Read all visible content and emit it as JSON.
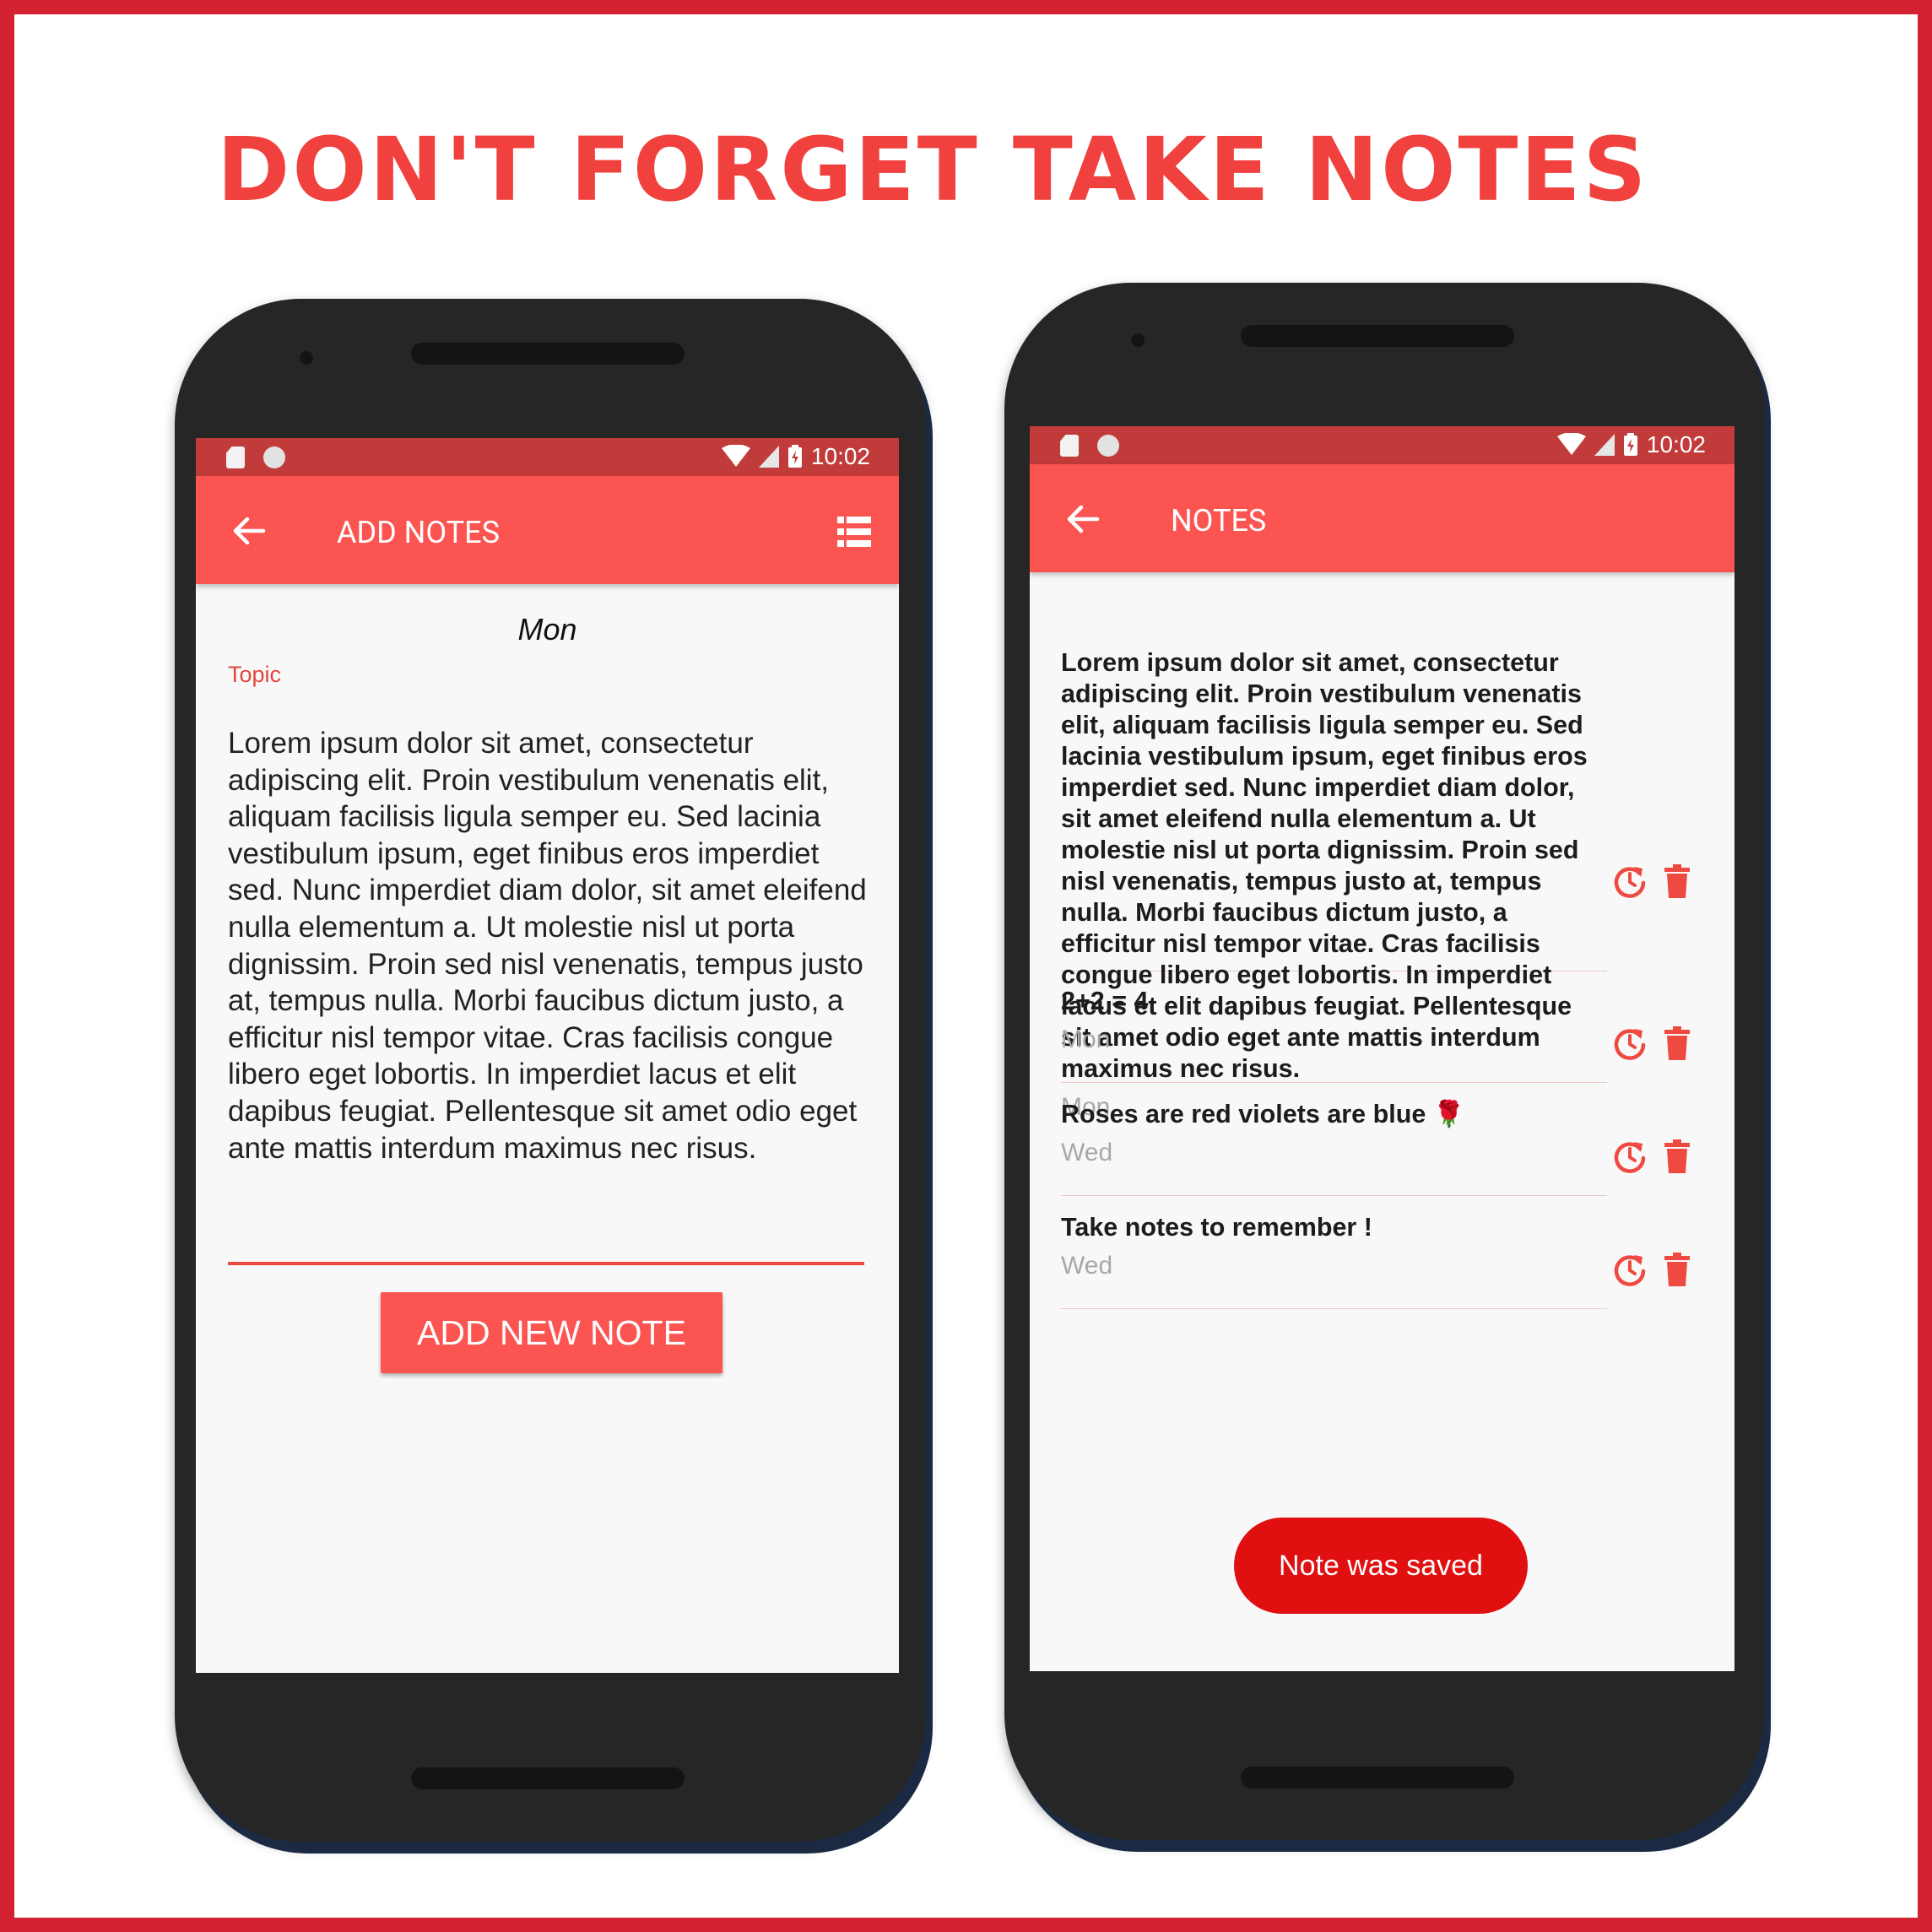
{
  "headline": "DON'T FORGET TAKE NOTES",
  "status_bar": {
    "time": "10:02"
  },
  "add_screen": {
    "title": "ADD NOTES",
    "day": "Mon",
    "topic_label": "Topic",
    "note_text": "Lorem ipsum dolor sit amet, consectetur adipiscing elit. Proin vestibulum venenatis elit, aliquam facilisis ligula semper eu. Sed lacinia vestibulum ipsum, eget finibus eros imperdiet sed. Nunc imperdiet diam dolor, sit amet eleifend nulla elementum a. Ut molestie nisl ut porta dignissim. Proin sed nisl venenatis, tempus justo at, tempus nulla. Morbi faucibus dictum justo, a efficitur nisl tempor vitae. Cras facilisis congue libero eget lobortis. In imperdiet lacus et elit dapibus feugiat. Pellentesque sit amet odio eget ante mattis interdum maximus nec risus.",
    "add_button_label": "ADD NEW NOTE"
  },
  "notes_screen": {
    "title": "NOTES",
    "notes": [
      {
        "text": "Lorem ipsum dolor sit amet, consectetur adipiscing elit. Proin vestibulum venenatis elit, aliquam facilisis ligula semper eu. Sed lacinia vestibulum ipsum, eget finibus eros imperdiet sed. Nunc imperdiet diam dolor, sit amet eleifend nulla elementum a. Ut molestie nisl ut porta dignissim. Proin sed nisl venenatis, tempus justo at, tempus nulla. Morbi faucibus dictum justo, a efficitur nisl tempor vitae. Cras facilisis congue libero eget lobortis. In imperdiet lacus et elit dapibus feugiat. Pellentesque sit amet odio eget ante mattis interdum maximus nec risus.",
        "day": "Mon"
      },
      {
        "text": "2+2 = 4",
        "day": "Mon"
      },
      {
        "text": "Roses are red violets are blue 🌹",
        "day": "Wed"
      },
      {
        "text": "Take notes to remember !",
        "day": "Wed"
      }
    ],
    "toast": "Note was saved"
  },
  "icons": {
    "back": "arrow-back-icon",
    "list": "list-view-icon",
    "reminder": "alarm-refresh-icon",
    "delete": "trash-icon"
  },
  "colors": {
    "frame": "#d42132",
    "headline": "#f0413e",
    "app_bar": "#fb5451",
    "status_bar": "#c23b3b",
    "toast": "#e00f10",
    "accent": "#ee4a44"
  }
}
